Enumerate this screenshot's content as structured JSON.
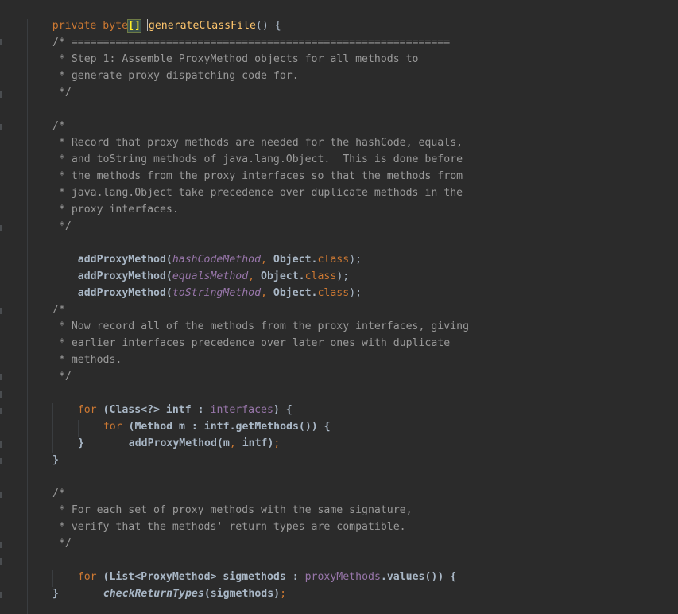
{
  "editor": {
    "theme": {
      "background": "#2b2b2b",
      "keyword": "#cc7832",
      "method_decl": "#ffc66d",
      "comment": "#9a9a9a",
      "field": "#9876aa",
      "text": "#a9b7c6",
      "bracket_highlight": "#ffef28"
    },
    "header": {
      "kw_private": "private",
      "kw_byte": "byte",
      "brackets": "[]",
      "method_name": "generateClassFile",
      "rest": "() {"
    },
    "step1_comment": {
      "open": "/* ============================================================",
      "l1": " * Step 1: Assemble ProxyMethod objects for all methods to",
      "l2": " * generate proxy dispatching code for.",
      "close": " */"
    },
    "record_comment": {
      "open": "/*",
      "l1": " * Record that proxy methods are needed for the hashCode, equals,",
      "l2": " * and toString methods of java.lang.Object.  This is done before",
      "l3": " * the methods from the proxy interfaces so that the methods from",
      "l4": " * java.lang.Object take precedence over duplicate methods in the",
      "l5": " * proxy interfaces.",
      "close": " */"
    },
    "add_calls": [
      {
        "fn": "addProxyMethod(",
        "arg": "hashCodeMethod",
        "comma": ", ",
        "obj": "Object.",
        "cls": "class",
        "end": ");"
      },
      {
        "fn": "addProxyMethod(",
        "arg": "equalsMethod",
        "comma": ", ",
        "obj": "Object.",
        "cls": "class",
        "end": ");"
      },
      {
        "fn": "addProxyMethod(",
        "arg": "toStringMethod",
        "comma": ", ",
        "obj": "Object.",
        "cls": "class",
        "end": ");"
      }
    ],
    "interfaces_comment": {
      "open": "/*",
      "l1": " * Now record all of the methods from the proxy interfaces, giving",
      "l2": " * earlier interfaces precedence over later ones with duplicate",
      "l3": " * methods.",
      "close": " */"
    },
    "for1": {
      "kw": "for",
      "a": " (Class<?> intf : ",
      "fld": "interfaces",
      "b": ") {"
    },
    "for2": {
      "kw": "for",
      "a": " (Method m : intf.getMethods()) {"
    },
    "inner_call": {
      "a": "addProxyMethod(m",
      "comma": ",",
      "b": " intf)",
      "semi": ";"
    },
    "close_brace": "}",
    "sig_comment": {
      "open": "/*",
      "l1": " * For each set of proxy methods with the same signature,",
      "l2": " * verify that the methods' return types are compatible.",
      "close": " */"
    },
    "for3": {
      "kw": "for",
      "a": " (List<ProxyMethod> sigmethods : ",
      "fld": "proxyMethods",
      "b": ".values()) {"
    },
    "check_call": {
      "fn": "checkReturnTypes",
      "a": "(sigmethods)",
      "semi": ";"
    }
  }
}
